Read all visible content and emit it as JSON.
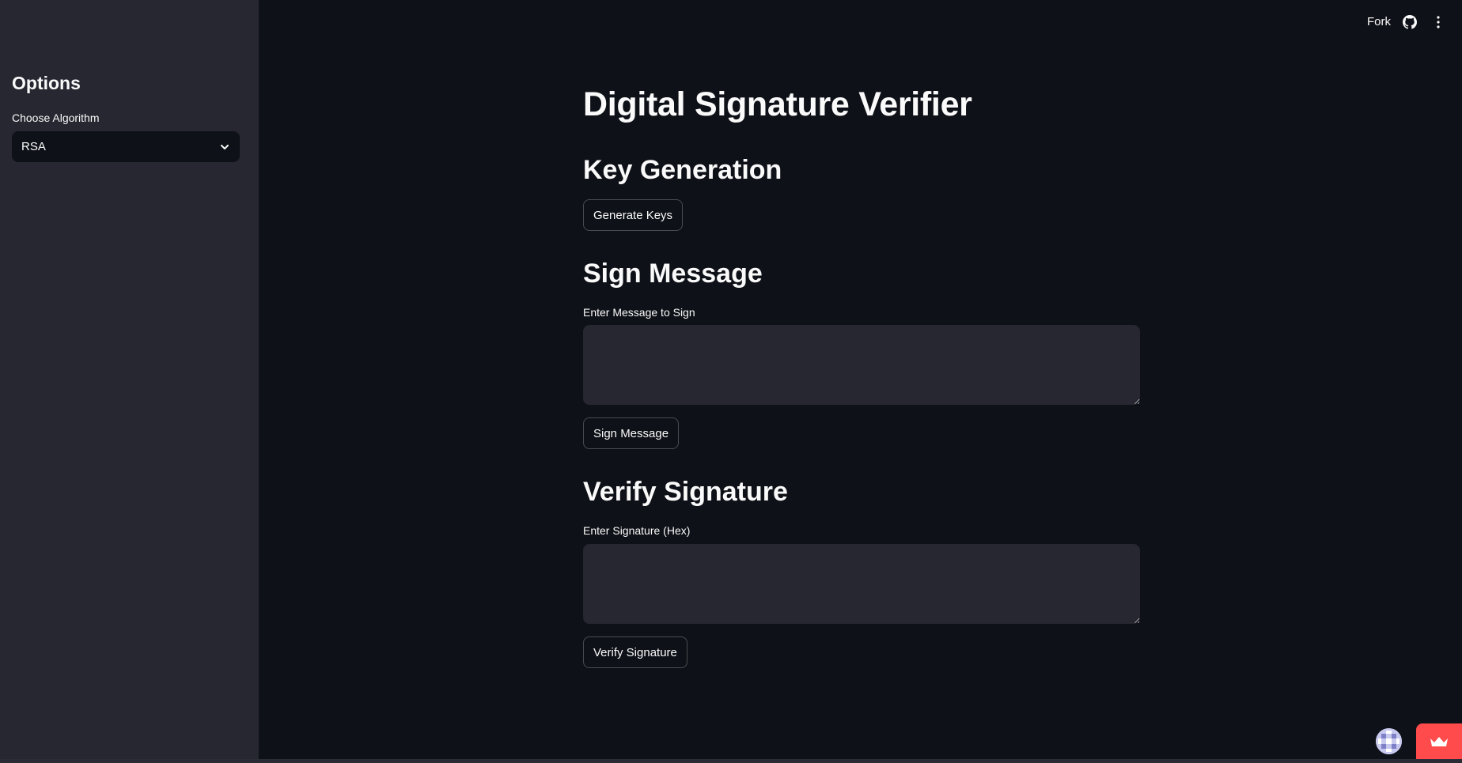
{
  "sidebar": {
    "title": "Options",
    "algorithm_label": "Choose Algorithm",
    "algorithm_value": "RSA"
  },
  "header": {
    "fork_label": "Fork"
  },
  "main": {
    "title": "Digital Signature Verifier",
    "key_generation": {
      "heading": "Key Generation",
      "button_label": "Generate Keys"
    },
    "sign": {
      "heading": "Sign Message",
      "input_label": "Enter Message to Sign",
      "input_value": "",
      "button_label": "Sign Message"
    },
    "verify": {
      "heading": "Verify Signature",
      "input_label": "Enter Signature (Hex)",
      "input_value": "",
      "button_label": "Verify Signature"
    }
  },
  "colors": {
    "background": "#0e1117",
    "sidebar": "#262730",
    "input_background": "#262730",
    "accent": "#ff4b4b",
    "text": "#fafafa"
  },
  "icons": {
    "select_chevron": "chevron-down-icon",
    "github": "github-icon",
    "menu": "kebab-menu-icon",
    "avatar": "avatar",
    "crown": "crown-icon"
  }
}
